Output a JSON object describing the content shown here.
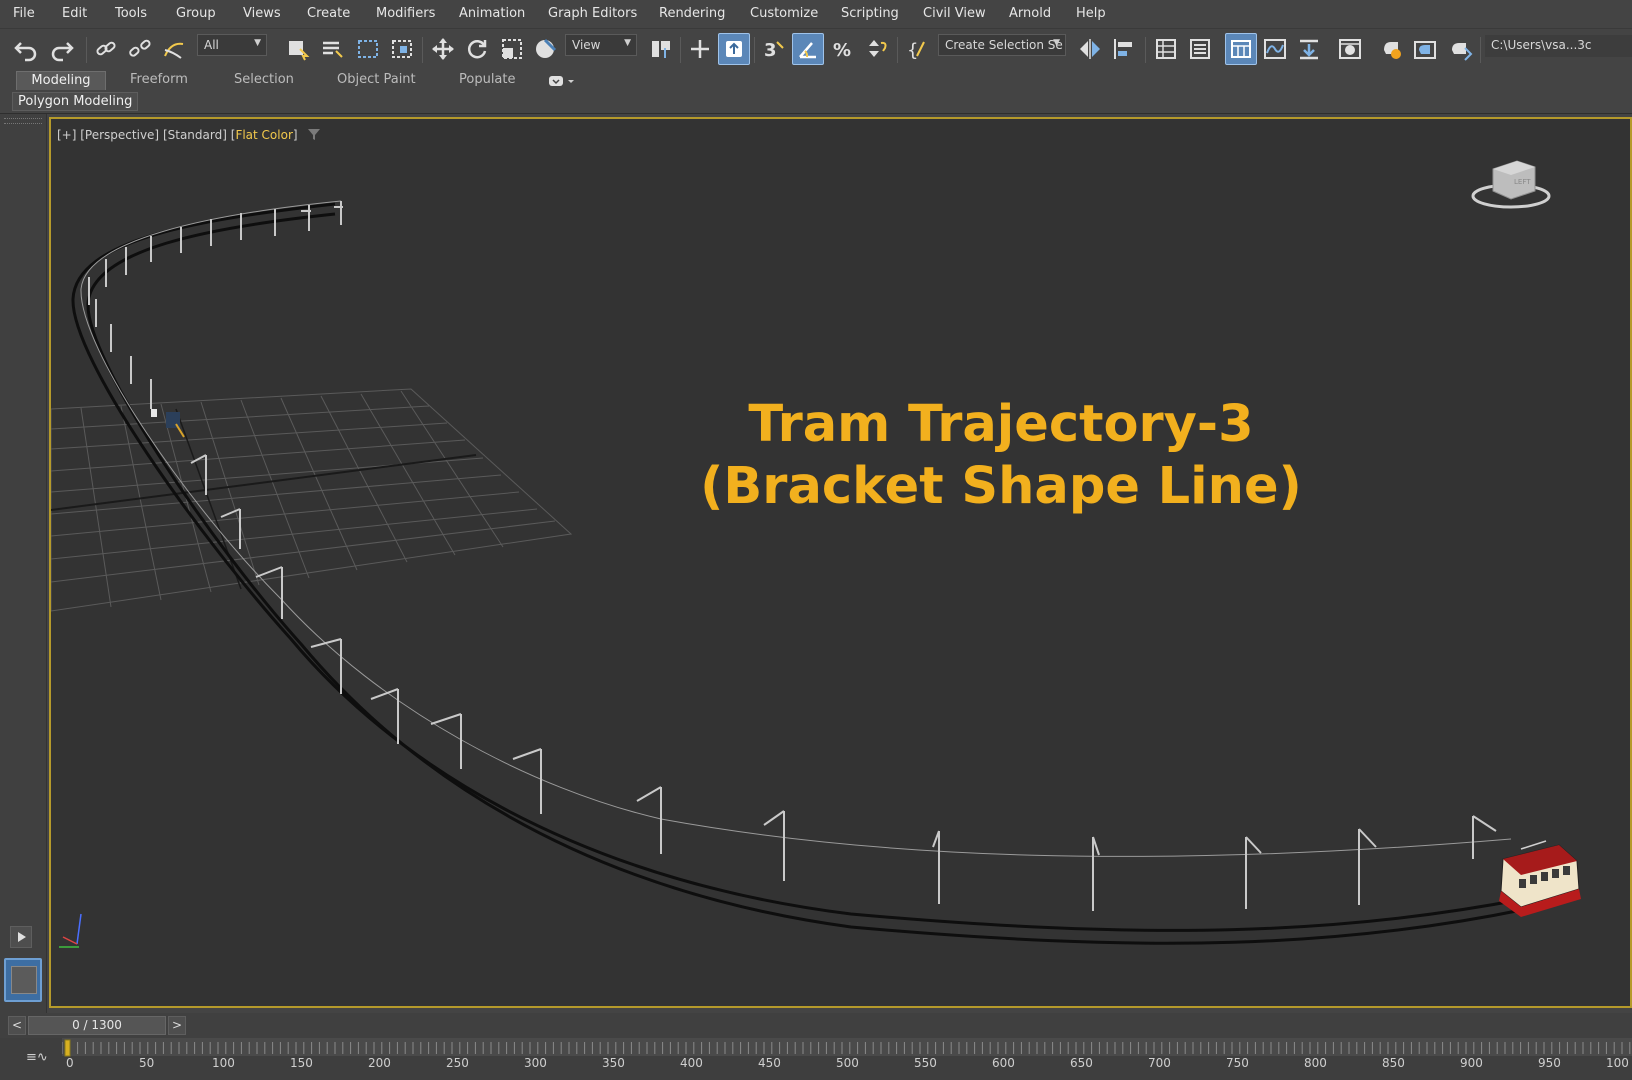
{
  "menu": [
    "File",
    "Edit",
    "Tools",
    "Group",
    "Views",
    "Create",
    "Modifiers",
    "Animation",
    "Graph Editors",
    "Rendering",
    "Customize",
    "Scripting",
    "Civil View",
    "Arnold",
    "Help"
  ],
  "toolbar": {
    "filter_select": "All",
    "coord_select": "View",
    "selection_set": "Create Selection Se",
    "path_field": "C:\\Users\\vsa...3c"
  },
  "ribbon": {
    "tabs": [
      "Modeling",
      "Freeform",
      "Selection",
      "Object Paint",
      "Populate"
    ],
    "active_tab": "Modeling",
    "panel_label": "Polygon Modeling"
  },
  "viewport": {
    "label_plus": "[+]",
    "label_view": "[Perspective]",
    "label_shading": "[Standard]",
    "label_flat_open": "[",
    "label_flat": "Flat Color",
    "label_flat_close": "]",
    "title_line1": "Tram  Trajectory-3",
    "title_line2": "(Bracket Shape Line)",
    "accent_color": "#f2b01e",
    "border_color": "#b59a2b"
  },
  "timeslider": {
    "frame": "0 / 1300",
    "prev_label": "<",
    "next_label": ">"
  },
  "trackbar": {
    "ticks": [
      "0",
      "50",
      "100",
      "150",
      "200",
      "250",
      "300",
      "350",
      "400",
      "450",
      "500",
      "550",
      "600",
      "650",
      "700",
      "750",
      "800",
      "850",
      "900",
      "950",
      "100"
    ]
  }
}
